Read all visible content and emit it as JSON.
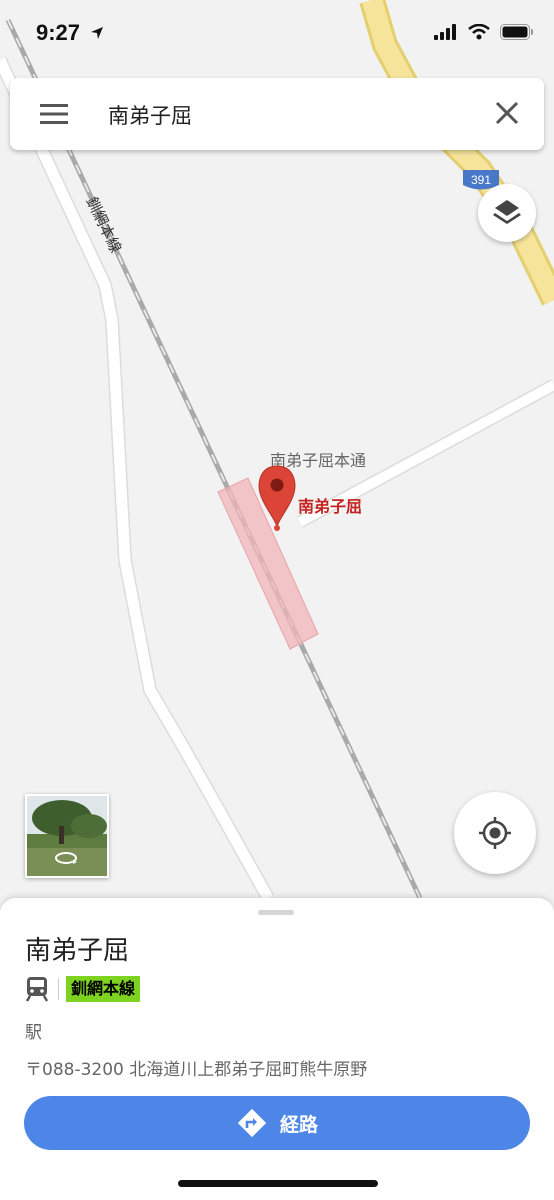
{
  "status_bar": {
    "time": "9:27"
  },
  "search": {
    "query": "南弟子屈"
  },
  "map": {
    "route_shield": "391",
    "rail_label": "釧網本線",
    "road_label": "南弟子屈本通",
    "pin_label": "南弟子屈",
    "pin_color": "#db4437"
  },
  "place": {
    "title": "南弟子屈",
    "line_badge": "釧網本線",
    "line_badge_color": "#7ed321",
    "category": "駅",
    "address": "〒088-3200 北海道川上郡弟子屈町熊牛原野"
  },
  "actions": {
    "route_label": "経路",
    "accent_color": "#4e86e8"
  },
  "icons": {
    "menu": "menu-icon",
    "close": "close-icon",
    "layers": "layers-icon",
    "locate": "my-location-icon",
    "train": "train-icon",
    "directions": "directions-icon",
    "rotate": "rotate-360-icon"
  }
}
